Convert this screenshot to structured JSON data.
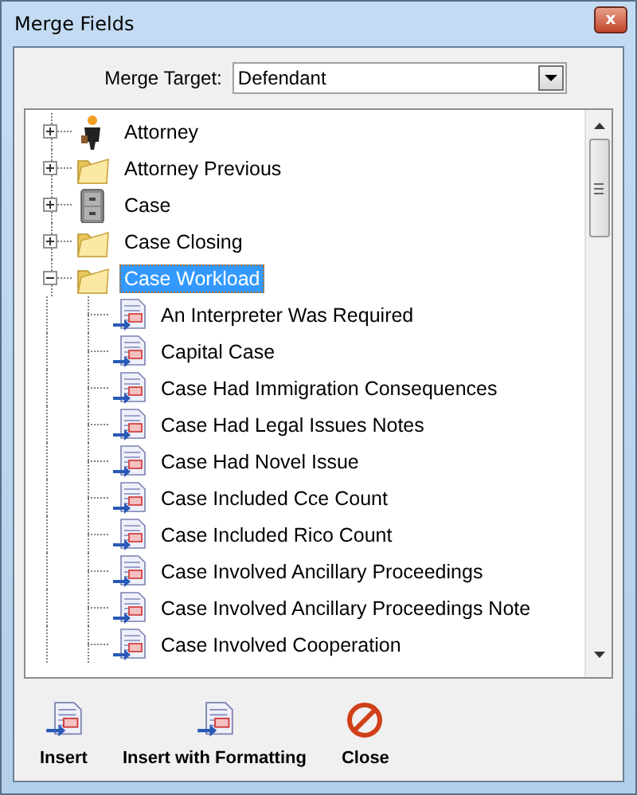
{
  "window": {
    "title": "Merge Fields",
    "close_glyph": "x"
  },
  "merge_target": {
    "label": "Merge Target:",
    "value": "Defendant"
  },
  "tree": [
    {
      "label": "Attorney",
      "kind": "person",
      "expanded": false,
      "selected": false
    },
    {
      "label": "Attorney Previous",
      "kind": "folder",
      "expanded": false,
      "selected": false
    },
    {
      "label": "Case",
      "kind": "cabinet",
      "expanded": false,
      "selected": false
    },
    {
      "label": "Case Closing",
      "kind": "folder",
      "expanded": false,
      "selected": false
    },
    {
      "label": "Case Workload",
      "kind": "folder",
      "expanded": true,
      "selected": true,
      "children": [
        {
          "label": "An Interpreter Was Required",
          "kind": "field",
          "selected": false
        },
        {
          "label": "Capital Case",
          "kind": "field",
          "selected": false
        },
        {
          "label": "Case Had Immigration Consequences",
          "kind": "field",
          "selected": false
        },
        {
          "label": "Case Had Legal Issues Notes",
          "kind": "field",
          "selected": false
        },
        {
          "label": "Case Had Novel Issue",
          "kind": "field",
          "selected": false
        },
        {
          "label": "Case Included Cce Count",
          "kind": "field",
          "selected": false
        },
        {
          "label": "Case Included Rico Count",
          "kind": "field",
          "selected": false
        },
        {
          "label": "Case Involved Ancillary Proceedings",
          "kind": "field",
          "selected": false
        },
        {
          "label": "Case Involved Ancillary Proceedings Note",
          "kind": "field",
          "selected": false
        },
        {
          "label": "Case Involved Cooperation",
          "kind": "field",
          "selected": false
        }
      ]
    }
  ],
  "buttons": [
    {
      "label": "Insert",
      "kind": "insert"
    },
    {
      "label": "Insert with Formatting",
      "kind": "insert"
    },
    {
      "label": "Close",
      "kind": "close"
    }
  ]
}
